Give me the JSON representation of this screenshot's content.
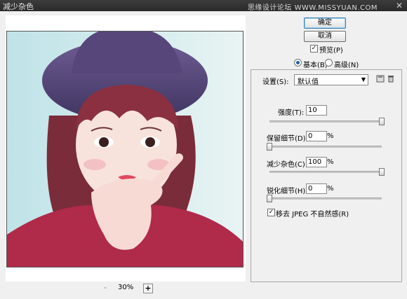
{
  "window": {
    "title": "减少杂色",
    "watermark": "思缘设计论坛 WWW.MISSYUAN.COM",
    "close": "✕"
  },
  "preview": {
    "zoom_minus": "-",
    "zoom_level": "30%",
    "zoom_plus": "+"
  },
  "buttons": {
    "ok": "确定",
    "cancel": "取消"
  },
  "preview_toggle": {
    "label": "预览(P)",
    "checked": true,
    "check_mark": "✓"
  },
  "mode": {
    "basic": "基本(B)",
    "advanced": "高级(N)",
    "selected": "basic"
  },
  "settings": {
    "label": "设置(S):",
    "value": "默认值",
    "arrow": "▼"
  },
  "params": [
    {
      "label": "强度(T):",
      "value": "10",
      "unit": "",
      "max": 10
    },
    {
      "label": "保留细节(D):",
      "value": "0",
      "unit": "%",
      "max": 100
    },
    {
      "label": "减少杂色(C):",
      "value": "100",
      "unit": "%",
      "max": 100
    },
    {
      "label": "锐化细节(H):",
      "value": "0",
      "unit": "%",
      "max": 100
    }
  ],
  "jpeg_option": {
    "label": "移去 JPEG 不自然感(R)",
    "checked": true,
    "check_mark": "✓"
  },
  "colors": {
    "accent": "#3c7fb1",
    "sweater": "#b02a4a",
    "hat": "#5a4a7c"
  }
}
